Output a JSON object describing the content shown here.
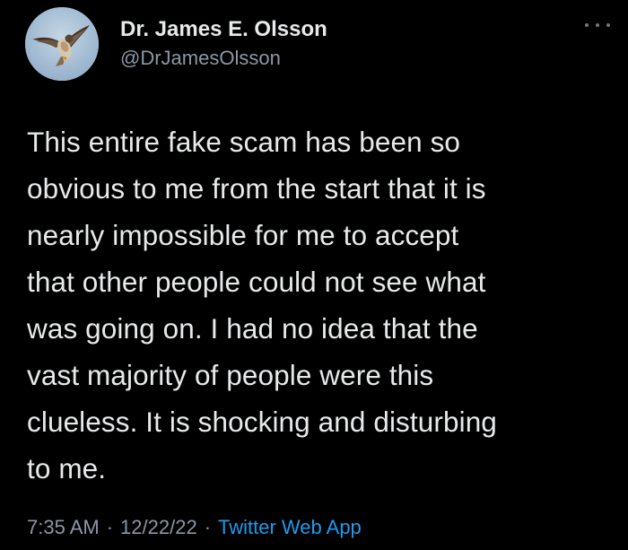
{
  "author": {
    "display_name": "Dr. James E. Olsson",
    "handle": "@DrJamesOlsson",
    "avatar_icon": "hawk-avatar-icon"
  },
  "tweet": {
    "text": "This entire fake scam has been so\nobvious to me from the start that it is\nnearly impossible for me to accept\nthat other people could not see what\nwas going on. I had no idea that the\nvast majority of people were this\nclueless. It is shocking and disturbing\nto me.",
    "time": "7:35 AM",
    "date": "12/22/22",
    "separator": "·",
    "source": "Twitter Web App"
  },
  "icons": {
    "more": "more-options-icon"
  },
  "colors": {
    "background": "#000000",
    "text": "#e7e9ea",
    "muted": "#8b98a5",
    "link": "#1d9bf0"
  }
}
